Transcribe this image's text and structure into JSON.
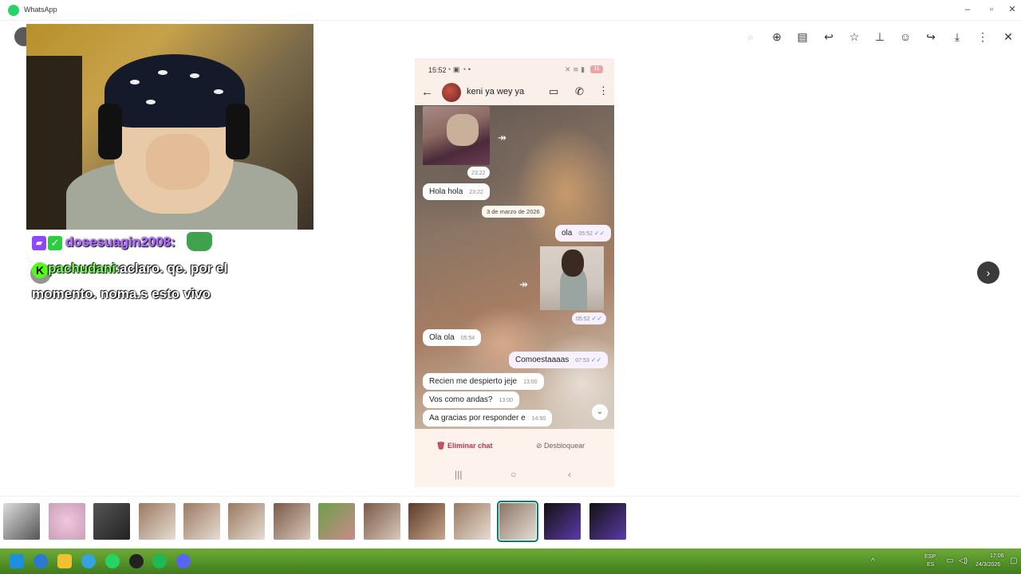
{
  "window": {
    "title": "WhatsApp"
  },
  "chat_overlay": {
    "user1": "dosesuagin2008:",
    "user2": "pachudani:",
    "msg2a": "aclaro. qe. por el",
    "msg2b": "momento. noma.s esto vivo"
  },
  "phone": {
    "status_time": "15:52",
    "battery": "11",
    "contact_name": "keni ya wey ya",
    "messages": {
      "time_cat": "23:22",
      "m1": {
        "text": "Hola hola",
        "time": "23:22"
      },
      "date_chip": "3 de marzo de 2026",
      "m2": {
        "text": "ola",
        "time": "05:52"
      },
      "time_person": "05:52",
      "m3": {
        "text": "Ola ola",
        "time": "05:54"
      },
      "m4": {
        "text": "Comoestaaaas",
        "time": "07:53"
      },
      "m5": {
        "text": "Recien me despierto jeje",
        "time": "13:00"
      },
      "m6": {
        "text": "Vos como andas?",
        "time": "13:00"
      },
      "m7": {
        "text": "Aa gracias por responder e",
        "time": "14:50"
      }
    },
    "footer": {
      "delete": "Eliminar chat",
      "unblock": "Desbloquear"
    }
  },
  "taskbar": {
    "lang1": "ESP",
    "lang2": "ES",
    "time": "17:06",
    "date": "24/3/2026"
  },
  "colors": {
    "accent": "#008069",
    "delete": "#b5374a"
  }
}
